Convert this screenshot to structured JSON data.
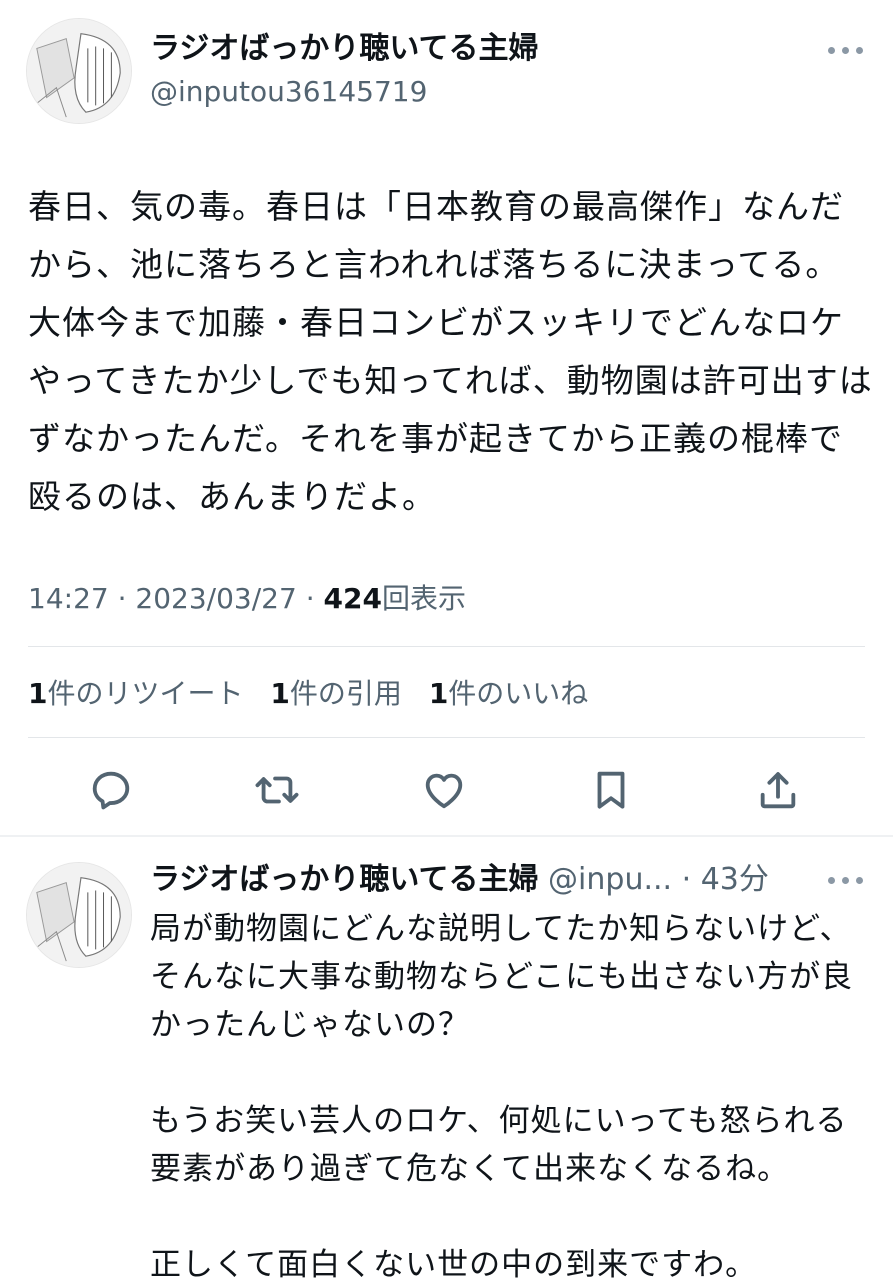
{
  "tweet": {
    "author_name": "ラジオばっかり聴いてる主婦",
    "author_handle": "@inputou36145719",
    "text": "春日、気の毒。春日は「日本教育の最高傑作」なんだから、池に落ちろと言われれば落ちるに決まってる。大体今まで加藤・春日コンビがスッキリでどんなロケやってきたか少しでも知ってれば、動物園は許可出すはずなかったんだ。それを事が起きてから正義の棍棒で殴るのは、あんまりだよ。",
    "time": "14:27",
    "date": "2023/03/27",
    "separator": "·",
    "views_count": "424",
    "views_label": "回表示",
    "retweets_count": "1",
    "retweets_label": "件のリツイート",
    "quotes_count": "1",
    "quotes_label": "件の引用",
    "likes_count": "1",
    "likes_label": "件のいいね"
  },
  "actions": {
    "icons": [
      "reply-icon",
      "retweet-icon",
      "like-icon",
      "bookmark-icon",
      "share-icon"
    ]
  },
  "reply": {
    "author_name": "ラジオばっかり聴いてる主婦",
    "author_handle": "@inpu...",
    "separator": "·",
    "time": "43分",
    "text": "局が動物園にどんな説明してたか知らないけど、そんなに大事な動物ならどこにも出さない方が良かったんじゃないの？\n\nもうお笑い芸人のロケ、何処にいっても怒られる要素があり過ぎて危なくて出来なくなるね。\n\n正しくて面白くない世の中の到来ですわ。"
  },
  "colors": {
    "text": "#0f1419",
    "secondary": "#536471",
    "divider": "#e3e6e9",
    "icon": "#536471"
  }
}
